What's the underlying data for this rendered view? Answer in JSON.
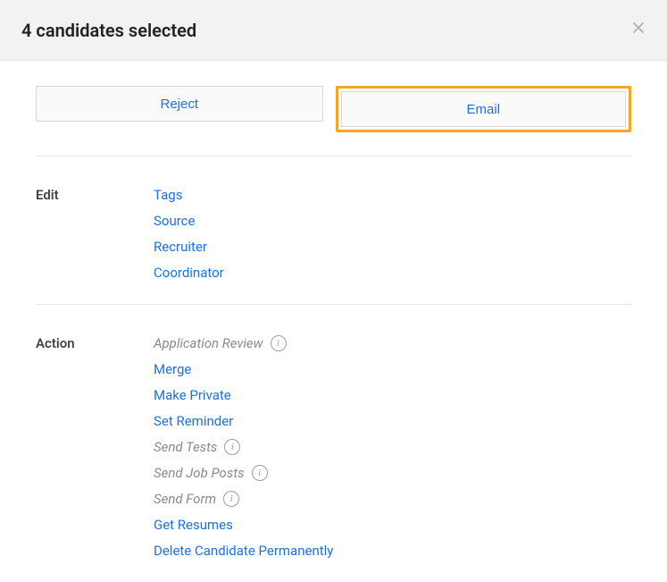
{
  "header": {
    "title": "4 candidates selected"
  },
  "buttons": {
    "reject": "Reject",
    "email": "Email"
  },
  "sections": {
    "edit": {
      "label": "Edit",
      "items": {
        "tags": "Tags",
        "source": "Source",
        "recruiter": "Recruiter",
        "coordinator": "Coordinator"
      }
    },
    "action": {
      "label": "Action",
      "items": {
        "application_review": "Application Review",
        "merge": "Merge",
        "make_private": "Make Private",
        "set_reminder": "Set Reminder",
        "send_tests": "Send Tests",
        "send_job_posts": "Send Job Posts",
        "send_form": "Send Form",
        "get_resumes": "Get Resumes",
        "delete_permanently": "Delete Candidate Permanently"
      }
    }
  }
}
